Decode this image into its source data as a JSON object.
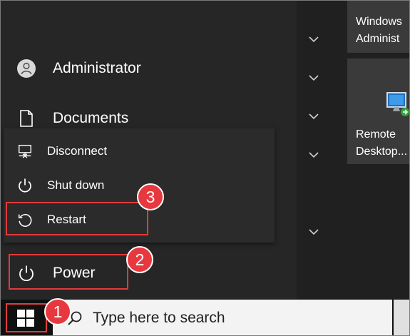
{
  "start_menu": {
    "user": {
      "label": "Administrator",
      "icon": "user-avatar-icon"
    },
    "documents": {
      "label": "Documents",
      "icon": "document-icon"
    },
    "power": {
      "label": "Power",
      "icon": "power-icon"
    }
  },
  "power_flyout": {
    "items": [
      {
        "label": "Disconnect",
        "icon": "disconnect-icon"
      },
      {
        "label": "Shut down",
        "icon": "power-icon"
      },
      {
        "label": "Restart",
        "icon": "restart-icon"
      }
    ]
  },
  "tiles": [
    {
      "label_line1": "Windows",
      "label_line2": "Administ"
    },
    {
      "label_line1": "Remote",
      "label_line2": "Desktop..."
    }
  ],
  "taskbar": {
    "search_placeholder": "Type here to search",
    "start_icon": "windows-logo-icon"
  },
  "callouts": [
    {
      "number": "1",
      "target": "start-button"
    },
    {
      "number": "2",
      "target": "power"
    },
    {
      "number": "3",
      "target": "restart"
    }
  ],
  "colors": {
    "callout_red": "#e8383f",
    "highlight_border": "#e03b3b",
    "menu_bg": "#262626",
    "flyout_bg": "#2b2b2b",
    "taskbar_bg": "#101010",
    "search_bg": "#f3f3f3"
  }
}
